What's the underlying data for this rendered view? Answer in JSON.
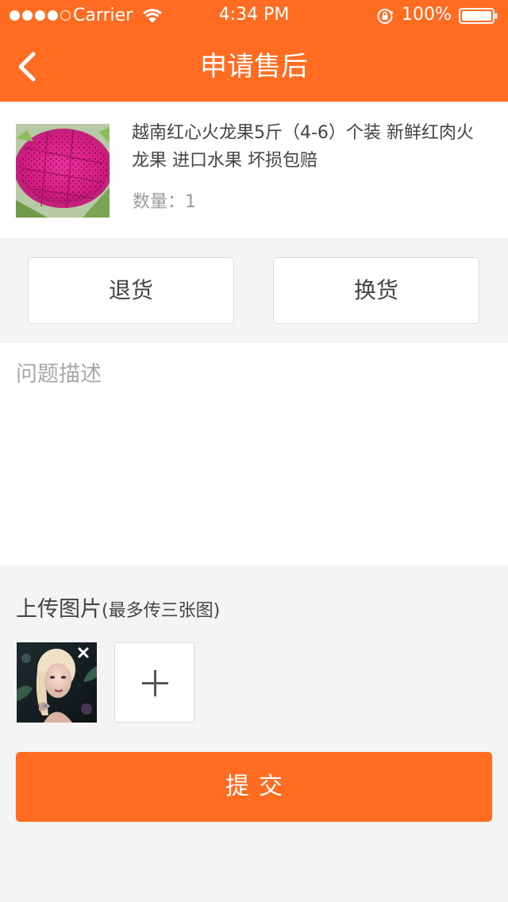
{
  "colors": {
    "accent": "#ff6c22",
    "background": "#f4f4f4"
  },
  "status_bar": {
    "carrier": "Carrier",
    "time": "4:34 PM",
    "battery": "100%",
    "signal_strength": "4 of 5 dots",
    "icons": [
      "wifi-icon",
      "rotation-lock-icon",
      "battery-icon"
    ]
  },
  "nav": {
    "back_icon": "chevron-left-icon",
    "title": "申请售后"
  },
  "product": {
    "image": "dragon-fruit-photo",
    "name": "越南红心火龙果5斤（4-6）个装 新鲜红肉火龙果 进口水果 坏损包赔",
    "quantity_label": "数量：",
    "quantity_value": "1"
  },
  "service_options": {
    "return_label": "退货",
    "exchange_label": "换货"
  },
  "description": {
    "placeholder": "问题描述",
    "value": ""
  },
  "upload": {
    "label": "上传图片",
    "hint": "(最多传三张图)",
    "thumbnails": [
      "portrait-photo"
    ],
    "remove_icon": "close-icon",
    "add_icon": "plus-icon"
  },
  "submit": {
    "label": "提交"
  }
}
